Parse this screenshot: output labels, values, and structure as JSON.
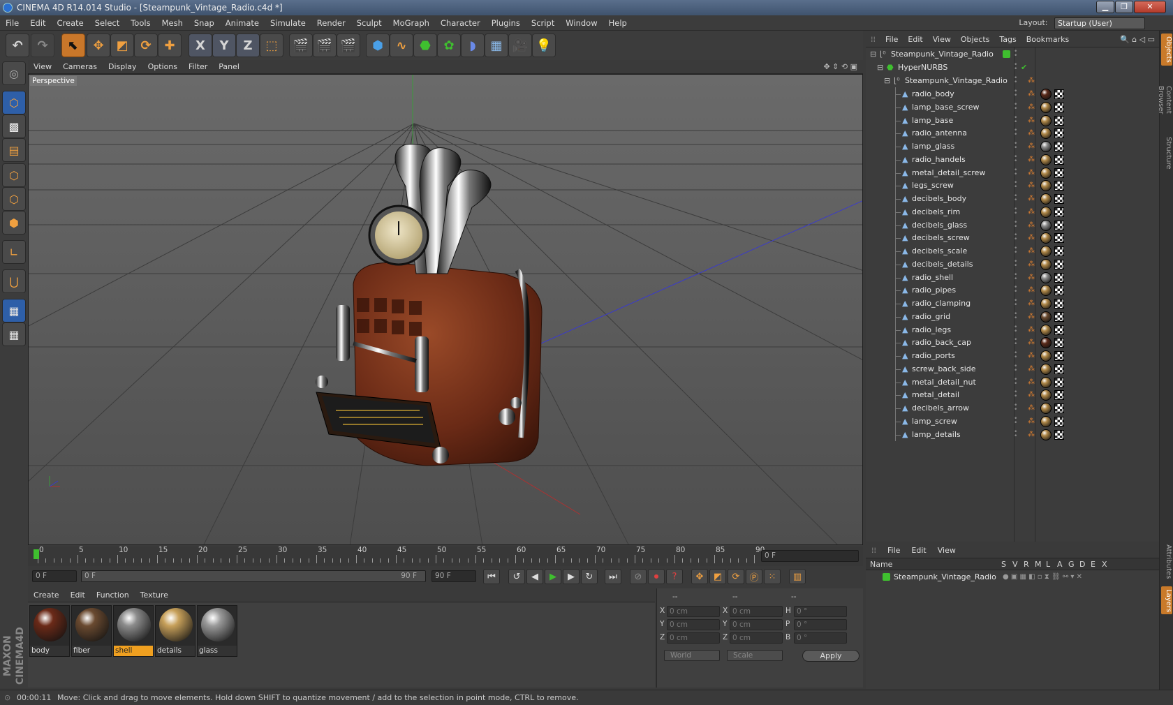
{
  "window": {
    "title": "CINEMA 4D R14.014 Studio - [Steampunk_Vintage_Radio.c4d *]",
    "minimize": "▁",
    "maximize": "❐",
    "close": "✕"
  },
  "menu": [
    "File",
    "Edit",
    "Create",
    "Select",
    "Tools",
    "Mesh",
    "Snap",
    "Animate",
    "Simulate",
    "Render",
    "Sculpt",
    "MoGraph",
    "Character",
    "Plugins",
    "Script",
    "Window",
    "Help"
  ],
  "layout": {
    "label": "Layout:",
    "value": "Startup (User)"
  },
  "toolbar": {
    "x_axis": "X",
    "y_axis": "Y",
    "z_axis": "Z"
  },
  "viewport": {
    "menu": [
      "View",
      "Cameras",
      "Display",
      "Options",
      "Filter",
      "Panel"
    ],
    "label": "Perspective"
  },
  "timeline": {
    "ticks": [
      "0",
      "5",
      "10",
      "15",
      "20",
      "25",
      "30",
      "35",
      "40",
      "45",
      "50",
      "55",
      "60",
      "65",
      "70",
      "75",
      "80",
      "85",
      "90"
    ],
    "current": "0 F"
  },
  "range": {
    "start": "0 F",
    "slider_start": "0 F",
    "slider_end": "90 F",
    "end": "90 F"
  },
  "materials": {
    "menu": [
      "Create",
      "Edit",
      "Function",
      "Texture"
    ],
    "items": [
      {
        "name": "body",
        "color": "#6b2a18"
      },
      {
        "name": "fiber",
        "color": "#6a4a30"
      },
      {
        "name": "shell",
        "color": "#8c8c8c",
        "selected": true
      },
      {
        "name": "details",
        "color": "#c7a05a"
      },
      {
        "name": "glass",
        "color": "#9a9a9a"
      }
    ]
  },
  "coords": {
    "headers": [
      "--",
      "--",
      "--"
    ],
    "rows": [
      {
        "a": "X",
        "av": "0 cm",
        "b": "X",
        "bv": "0 cm",
        "c": "H",
        "cv": "0 °"
      },
      {
        "a": "Y",
        "av": "0 cm",
        "b": "Y",
        "bv": "0 cm",
        "c": "P",
        "cv": "0 °"
      },
      {
        "a": "Z",
        "av": "0 cm",
        "b": "Z",
        "bv": "0 cm",
        "c": "B",
        "cv": "0 °"
      }
    ],
    "world": "World",
    "scale": "Scale",
    "apply": "Apply"
  },
  "status": {
    "time": "00:00:11",
    "message": "Move: Click and drag to move elements. Hold down SHIFT to quantize movement / add to the selection in point mode, CTRL to remove."
  },
  "objects": {
    "menu": [
      "File",
      "Edit",
      "View",
      "Objects",
      "Tags",
      "Bookmarks"
    ],
    "root": "Steampunk_Vintage_Radio",
    "nurbs": "HyperNURBS",
    "group": "Steampunk_Vintage_Radio",
    "items": [
      {
        "name": "radio_body",
        "mat": "#5a2a1a"
      },
      {
        "name": "lamp_base_screw",
        "mat": "#b08848"
      },
      {
        "name": "lamp_base",
        "mat": "#b08848"
      },
      {
        "name": "radio_antenna",
        "mat": "#b08848"
      },
      {
        "name": "lamp_glass",
        "mat": "#8a8a8a"
      },
      {
        "name": "radio_handels",
        "mat": "#b08848"
      },
      {
        "name": "metal_detail_screw",
        "mat": "#b08848"
      },
      {
        "name": "legs_screw",
        "mat": "#b08848"
      },
      {
        "name": "decibels_body",
        "mat": "#b08848"
      },
      {
        "name": "decibels_rim",
        "mat": "#b08848"
      },
      {
        "name": "decibels_glass",
        "mat": "#8a8a8a"
      },
      {
        "name": "decibels_screw",
        "mat": "#b08848"
      },
      {
        "name": "decibels_scale",
        "mat": "#b08848"
      },
      {
        "name": "decibels_details",
        "mat": "#b08848"
      },
      {
        "name": "radio_shell",
        "mat": "#8a8a8a"
      },
      {
        "name": "radio_pipes",
        "mat": "#b08848"
      },
      {
        "name": "radio_clamping",
        "mat": "#b08848"
      },
      {
        "name": "radio_grid",
        "mat": "#6a4a30"
      },
      {
        "name": "radio_legs",
        "mat": "#b08848"
      },
      {
        "name": "radio_back_cap",
        "mat": "#5a2a1a"
      },
      {
        "name": "radio_ports",
        "mat": "#b08848"
      },
      {
        "name": "screw_back_side",
        "mat": "#b08848"
      },
      {
        "name": "metal_detail_nut",
        "mat": "#b08848"
      },
      {
        "name": "metal_detail",
        "mat": "#b08848"
      },
      {
        "name": "decibels_arrow",
        "mat": "#b08848"
      },
      {
        "name": "lamp_screw",
        "mat": "#b08848"
      },
      {
        "name": "lamp_details",
        "mat": "#b08848"
      }
    ]
  },
  "layers": {
    "menu": [
      "File",
      "Edit",
      "View"
    ],
    "cols": [
      "Name",
      "S",
      "V",
      "R",
      "M",
      "L",
      "A",
      "G",
      "D",
      "E",
      "X"
    ],
    "item": "Steampunk_Vintage_Radio"
  },
  "sidetabs": {
    "objects": "Objects",
    "content": "Content Browser",
    "structure": "Structure",
    "attributes": "Attributes",
    "layers": "Layers"
  },
  "colors": {
    "accent": "#c9772a",
    "green": "#3fbf2f",
    "selection": "#2e5fa8"
  }
}
